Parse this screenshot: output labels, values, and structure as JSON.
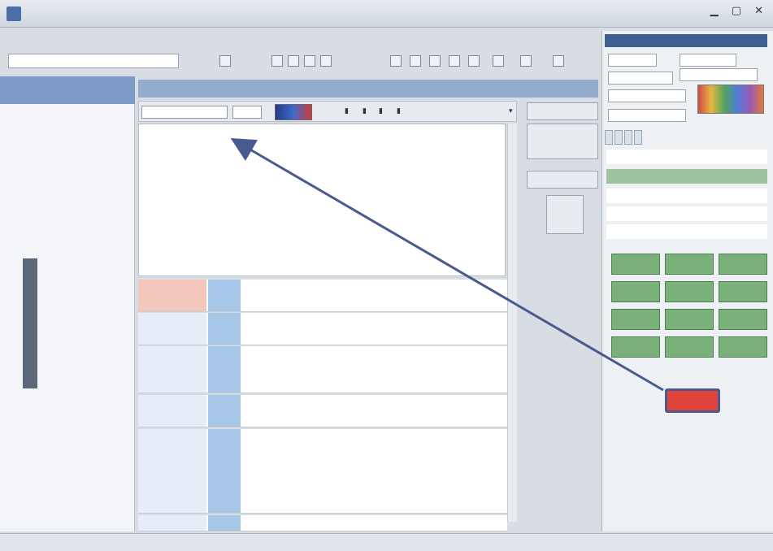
{
  "window": {
    "title": ""
  },
  "menu": {
    "items": [
      "",
      "",
      "",
      "",
      "",
      "",
      "",
      "",
      ""
    ]
  },
  "toolbar": {
    "search_value": ""
  },
  "left": {
    "header": "",
    "tree": [
      "",
      "",
      "",
      "",
      "",
      "",
      "",
      "",
      "",
      "",
      "",
      "",
      "",
      "",
      "",
      "",
      "",
      "",
      "",
      "",
      "",
      "",
      ""
    ],
    "vertical_label": ""
  },
  "center": {
    "header": "",
    "font": "",
    "size": "",
    "editor_line": "",
    "notes": [
      {
        "date": "",
        "type": "",
        "text": ""
      },
      {
        "date": "",
        "type": "",
        "text": ""
      },
      {
        "date": "",
        "type": "",
        "text": ""
      },
      {
        "date": "",
        "type": "",
        "text": ""
      },
      {
        "date": "",
        "type": "",
        "text": ""
      },
      {
        "date": "",
        "type": "",
        "text": ""
      }
    ]
  },
  "side_buttons": [
    "",
    "",
    "",
    ""
  ],
  "right": {
    "title": "",
    "tabs": [
      "",
      "",
      "",
      ""
    ],
    "info": [
      "",
      "",
      "",
      "",
      ""
    ],
    "grid_buttons": [
      "",
      "",
      "",
      "",
      "",
      "",
      "",
      "",
      "",
      "",
      "",
      ""
    ],
    "bottom_row": [
      "",
      "",
      "",
      ""
    ]
  },
  "status": {
    "left": "",
    "middle_a": "",
    "middle_b": "",
    "right": ""
  },
  "colors": {
    "accent_red": "#e0443a",
    "annotation_arrow": "#4a5a90",
    "grid_green": "#7ab07a",
    "header_blue": "#94adcf"
  }
}
